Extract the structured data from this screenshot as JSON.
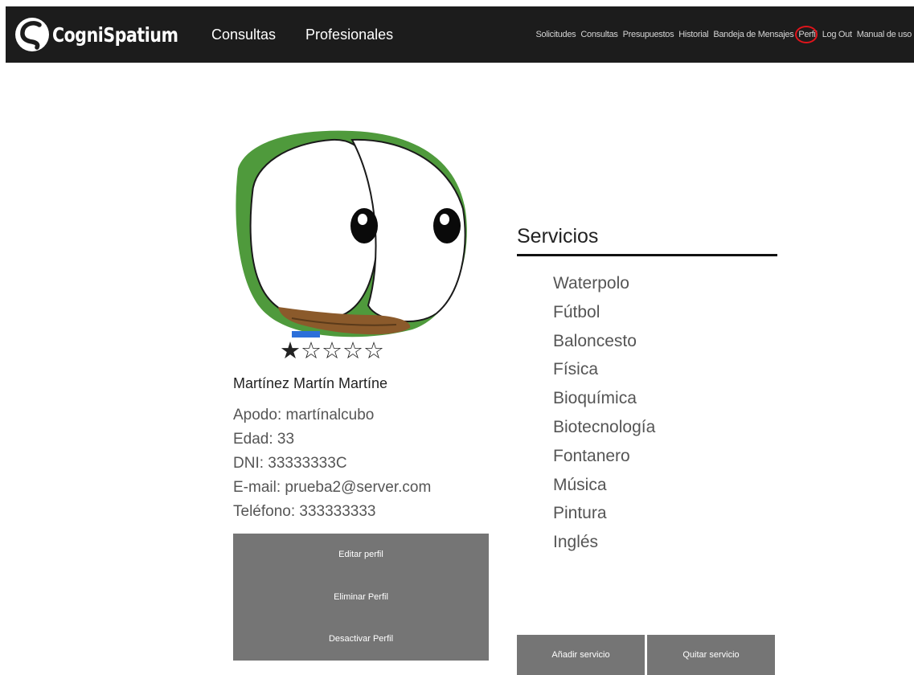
{
  "navbar": {
    "brand": "CogniSpatium",
    "main_links": [
      "Consultas",
      "Profesionales"
    ],
    "sub_links": [
      "Solicitudes",
      "Consultas",
      "Presupuestos",
      "Historial",
      "Bandeja de Mensajes",
      "Perfil",
      "Log Out",
      "Manual de uso"
    ],
    "highlight_color": "#e0141b"
  },
  "profile": {
    "rating": {
      "value": 1,
      "max": 5
    },
    "name": "Martínez Martín Martíne",
    "fields": [
      "Apodo: martínalcubo",
      "Edad: 33",
      "DNI: 33333333C",
      "E-mail: prueba2@server.com",
      "Teléfono: 333333333"
    ],
    "actions": [
      "Editar perfil",
      "Eliminar Perfil",
      "Desactivar Perfil"
    ]
  },
  "services": {
    "title": "Servicios",
    "items": [
      "Waterpolo",
      "Fútbol",
      "Baloncesto",
      "Física",
      "Bioquímica",
      "Biotecnología",
      "Fontanero",
      "Música",
      "Pintura",
      "Inglés"
    ],
    "add_label": "Añadir servicio",
    "remove_label": "Quitar servicio"
  },
  "colors": {
    "navbar_bg": "#1c1c1c",
    "button_bg": "#757575",
    "avatar_green": "#4f9a3c"
  }
}
